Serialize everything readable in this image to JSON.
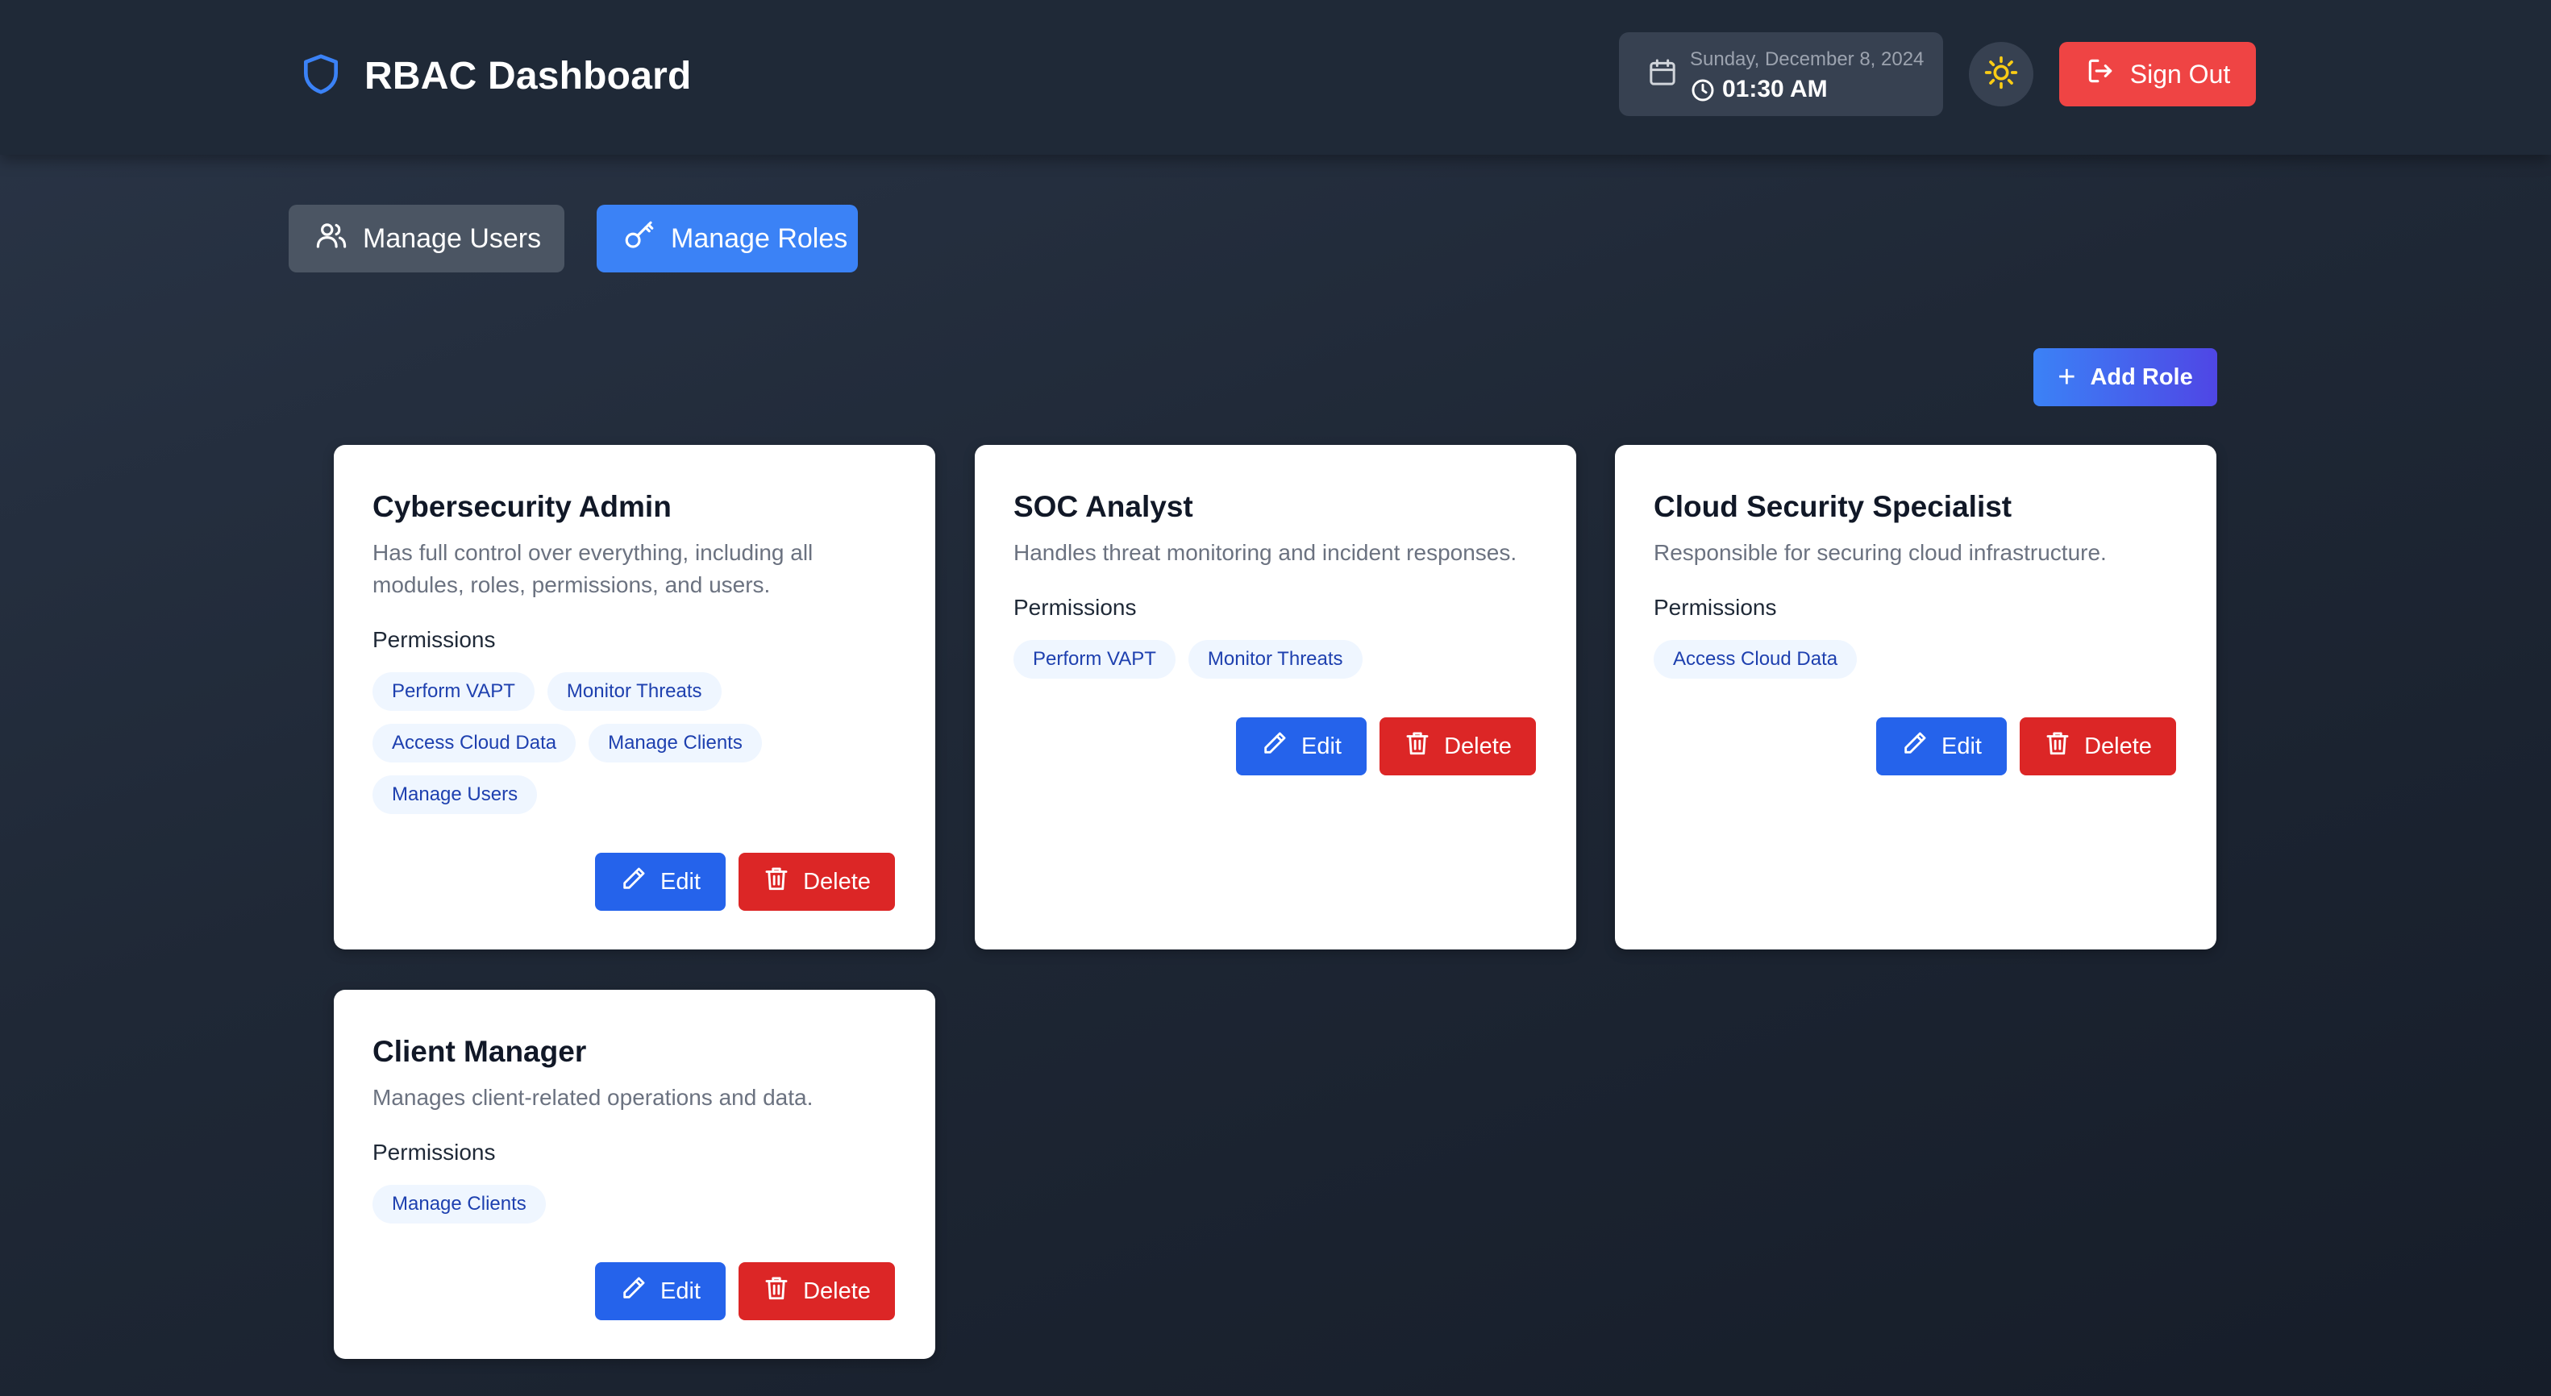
{
  "header": {
    "title": "RBAC Dashboard",
    "date": "Sunday, December 8, 2024",
    "time": "01:30 AM",
    "sign_out_label": "Sign Out",
    "icons": {
      "brand": "shield-icon",
      "date": "calendar-icon",
      "time": "clock-icon",
      "theme": "sun-icon",
      "sign_out": "log-out-icon"
    }
  },
  "tabs": [
    {
      "label": "Manage Users",
      "icon": "users-icon",
      "active": false
    },
    {
      "label": "Manage Roles",
      "icon": "key-icon",
      "active": true
    }
  ],
  "add_role_label": "Add Role",
  "permissions_label": "Permissions",
  "edit_label": "Edit",
  "delete_label": "Delete",
  "roles": [
    {
      "name": "Cybersecurity Admin",
      "description": "Has full control over everything, including all modules, roles, permissions, and users.",
      "permissions": [
        "Perform VAPT",
        "Monitor Threats",
        "Access Cloud Data",
        "Manage Clients",
        "Manage Users"
      ]
    },
    {
      "name": "SOC Analyst",
      "description": "Handles threat monitoring and incident responses.",
      "permissions": [
        "Perform VAPT",
        "Monitor Threats"
      ]
    },
    {
      "name": "Cloud Security Specialist",
      "description": "Responsible for securing cloud infrastructure.",
      "permissions": [
        "Access Cloud Data"
      ]
    },
    {
      "name": "Client Manager",
      "description": "Manages client-related operations and data.",
      "permissions": [
        "Manage Clients"
      ]
    }
  ],
  "colors": {
    "accent": "#3b82f6",
    "danger": "#dc2626",
    "sign_out": "#ef4444",
    "chip_bg": "#eff6ff",
    "chip_text": "#1e40af",
    "sun": "#facc15"
  }
}
